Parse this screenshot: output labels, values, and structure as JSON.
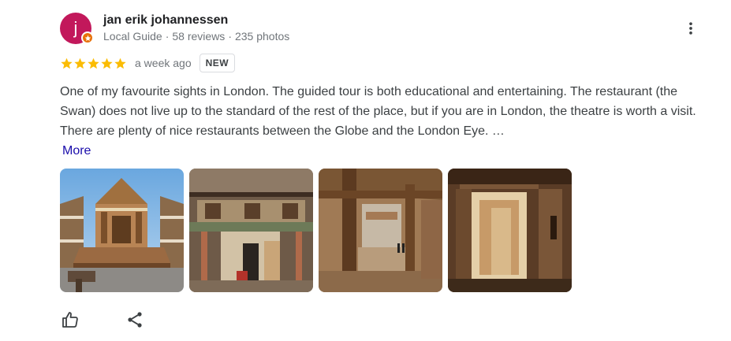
{
  "review": {
    "author": {
      "name": "jan erik johannessen",
      "initial": "j",
      "avatar_color": "#c2185b",
      "badge_color": "#e8710a",
      "local_guide_label": "Local Guide",
      "reviews_count": "58 reviews",
      "photos_count": "235 photos"
    },
    "rating": {
      "stars": 5,
      "max": 5,
      "star_color": "#fbbc04"
    },
    "time": "a week ago",
    "new_badge": "NEW",
    "text": "One of my favourite sights in London. The guided tour is both educational and entertaining. The restaurant (the Swan) does not live up to the standard of the rest of the place, but if you are in London, the theatre is worth a visit. There are plenty of nice restaurants between the Globe and the London Eye. …",
    "more_label": "More",
    "photos": [
      {
        "name": "globe-stage-photo",
        "icon": "photo"
      },
      {
        "name": "stage-frons-photo",
        "icon": "photo"
      },
      {
        "name": "interior-beams-photo",
        "icon": "photo"
      },
      {
        "name": "corridor-photo",
        "icon": "photo"
      }
    ],
    "actions": [
      {
        "name": "like-button",
        "icon": "thumb-up-icon"
      },
      {
        "name": "share-button",
        "icon": "share-icon"
      }
    ],
    "menu_icon": "more-vert-icon",
    "link_color": "#1a0dab"
  }
}
